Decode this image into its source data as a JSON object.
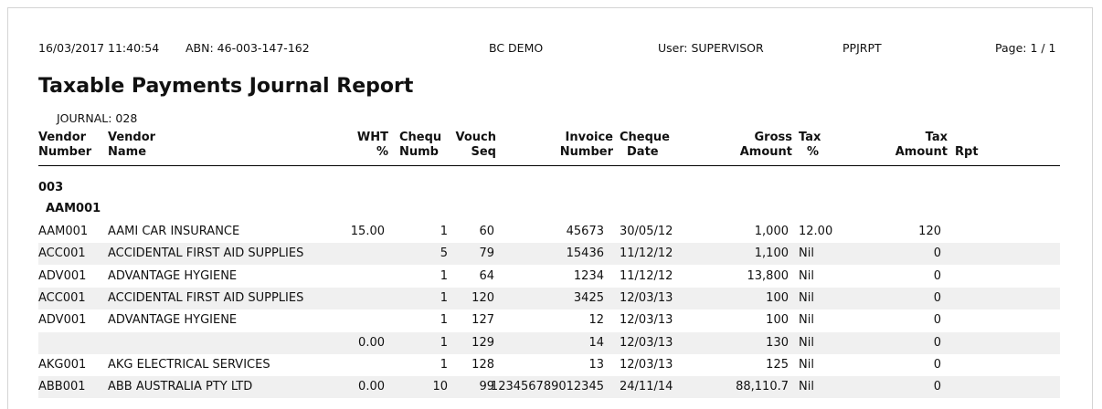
{
  "header": {
    "datetime": "16/03/2017 11:40:54",
    "abn": "ABN: 46-003-147-162",
    "company": "BC DEMO",
    "user": "User: SUPERVISOR",
    "report_code": "PPJRPT",
    "page": "Page: 1 / 1"
  },
  "title": "Taxable Payments Journal Report",
  "journal": "JOURNAL: 028",
  "columns": {
    "vendor_number": [
      "Vendor",
      "Number"
    ],
    "vendor_name": [
      "Vendor",
      "Name"
    ],
    "wht": [
      "WHT",
      "%"
    ],
    "cheque_numb": [
      "Chequ",
      "Numb"
    ],
    "vouch_seq": [
      "Vouch",
      "Seq"
    ],
    "invoice_number": [
      "Invoice",
      "Number"
    ],
    "cheque_date": [
      "Cheque",
      "Date"
    ],
    "gross_amount": [
      "Gross",
      "Amount"
    ],
    "tax_pct": [
      "Tax",
      "%"
    ],
    "tax_amount": [
      "Tax",
      "Amount"
    ],
    "rpt": "Rpt"
  },
  "groups": {
    "level1": "003",
    "level2": "AAM001"
  },
  "rows": [
    {
      "vendor": "AAM001",
      "name": "AAMI CAR INSURANCE",
      "wht": "15.00",
      "chq": "1",
      "seq": "60",
      "inv": "45673",
      "date": "30/05/12",
      "gross": "1,000",
      "taxp": "12.00",
      "taxa": "120",
      "rpt": ""
    },
    {
      "vendor": "ACC001",
      "name": "ACCIDENTAL FIRST AID SUPPLIES",
      "wht": "",
      "chq": "5",
      "seq": "79",
      "inv": "15436",
      "date": "11/12/12",
      "gross": "1,100",
      "taxp": "Nil",
      "taxa": "0",
      "rpt": ""
    },
    {
      "vendor": "ADV001",
      "name": "ADVANTAGE HYGIENE",
      "wht": "",
      "chq": "1",
      "seq": "64",
      "inv": "1234",
      "date": "11/12/12",
      "gross": "13,800",
      "taxp": "Nil",
      "taxa": "0",
      "rpt": ""
    },
    {
      "vendor": "ACC001",
      "name": "ACCIDENTAL FIRST AID SUPPLIES",
      "wht": "",
      "chq": "1",
      "seq": "120",
      "inv": "3425",
      "date": "12/03/13",
      "gross": "100",
      "taxp": "Nil",
      "taxa": "0",
      "rpt": ""
    },
    {
      "vendor": "ADV001",
      "name": "ADVANTAGE HYGIENE",
      "wht": "",
      "chq": "1",
      "seq": "127",
      "inv": "12",
      "date": "12/03/13",
      "gross": "100",
      "taxp": "Nil",
      "taxa": "0",
      "rpt": ""
    },
    {
      "vendor": "",
      "name": "",
      "wht": "0.00",
      "chq": "1",
      "seq": "129",
      "inv": "14",
      "date": "12/03/13",
      "gross": "130",
      "taxp": "Nil",
      "taxa": "0",
      "rpt": ""
    },
    {
      "vendor": "AKG001",
      "name": "AKG ELECTRICAL SERVICES",
      "wht": "",
      "chq": "1",
      "seq": "128",
      "inv": "13",
      "date": "12/03/13",
      "gross": "125",
      "taxp": "Nil",
      "taxa": "0",
      "rpt": ""
    },
    {
      "vendor": "ABB001",
      "name": "ABB AUSTRALIA PTY LTD",
      "wht": "0.00",
      "chq": "10",
      "seq": "99",
      "inv": "123456789012345",
      "date": "24/11/14",
      "gross": "88,110.7",
      "taxp": "Nil",
      "taxa": "0",
      "rpt": ""
    }
  ]
}
